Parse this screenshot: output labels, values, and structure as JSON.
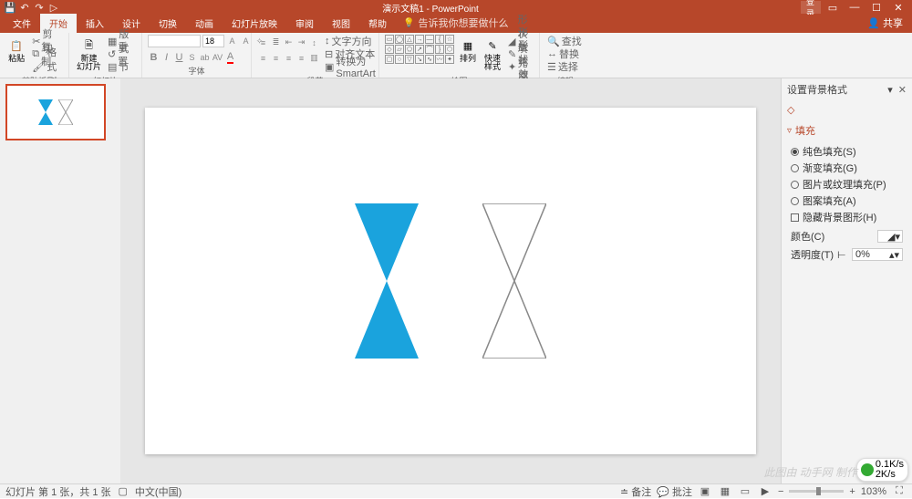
{
  "title": "演示文稿1 - PowerPoint",
  "login_label": "登录",
  "tabs": {
    "file": "文件",
    "home": "开始",
    "insert": "插入",
    "design": "设计",
    "transitions": "切换",
    "animations": "动画",
    "slideshow": "幻灯片放映",
    "review": "审阅",
    "view": "视图",
    "help": "帮助",
    "tellme": "告诉我你想要做什么"
  },
  "share": "共享",
  "groups": {
    "clipboard": {
      "label": "剪贴板",
      "paste": "粘贴",
      "cut": "剪切",
      "copy": "复制",
      "format_painter": "格式刷"
    },
    "slides": {
      "label": "幻灯片",
      "new_slide": "新建\n幻灯片",
      "layout": "版式",
      "reset": "重置",
      "section": "节"
    },
    "font": {
      "label": "字体",
      "size": "18"
    },
    "paragraph": {
      "label": "段落",
      "text_direction": "文字方向",
      "align_text": "对齐文本",
      "smartart": "转换为 SmartArt"
    },
    "drawing": {
      "label": "绘图",
      "arrange": "排列",
      "quick_styles": "快速样式",
      "shape_fill": "形状填充",
      "shape_outline": "形状轮廓",
      "shape_effects": "形状效果"
    },
    "editing": {
      "label": "编辑",
      "find": "查找",
      "replace": "替换",
      "select": "选择"
    }
  },
  "pane": {
    "title": "设置背景格式",
    "fill_section": "填充",
    "options": {
      "solid": "纯色填充(S)",
      "gradient": "渐变填充(G)",
      "picture": "图片或纹理填充(P)",
      "pattern": "图案填充(A)",
      "hide": "隐藏背景图形(H)"
    },
    "color_label": "颜色(C)",
    "transparency_label": "透明度(T)",
    "transparency_value": "0%"
  },
  "status": {
    "slide_info": "幻灯片 第 1 张，共 1 张",
    "language": "中文(中国)",
    "notes": "备注",
    "comments": "批注",
    "zoom": "103%"
  },
  "bitrate": {
    "up": "0.1K/s",
    "down": "2K/s"
  },
  "watermark": "此图由 动手网 制作"
}
